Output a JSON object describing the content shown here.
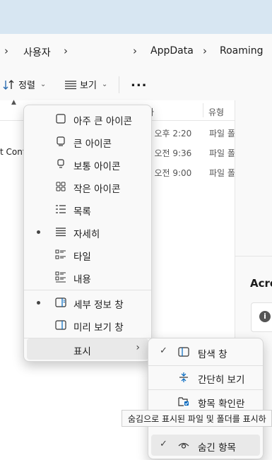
{
  "address": {
    "crumbs": [
      "사용자",
      "AppData",
      "Roaming"
    ]
  },
  "toolbar": {
    "sort_label": "정렬",
    "view_label": "보기",
    "more_label": "..."
  },
  "filelist": {
    "col_date_fragment": "가",
    "col_type": "유형",
    "left_fragment": "t Cont",
    "rows": [
      {
        "date": "4 오후 2:20",
        "type": "파일 폴"
      },
      {
        "date": "5 오전 9:36",
        "type": "파일 폴"
      },
      {
        "date": "2 오전 9:00",
        "type": "파일 폴"
      }
    ]
  },
  "detail_pane": {
    "title_fragment": "Acro",
    "info_icon": "i"
  },
  "view_menu": {
    "items": [
      {
        "label": "아주 큰 아이콘",
        "icon": "xl-icon"
      },
      {
        "label": "큰 아이콘",
        "icon": "large-icon"
      },
      {
        "label": "보통 아이콘",
        "icon": "medium-icon"
      },
      {
        "label": "작은 아이콘",
        "icon": "small-icons-icon"
      },
      {
        "label": "목록",
        "icon": "list-icon"
      },
      {
        "label": "자세히",
        "icon": "details-icon",
        "selected": true
      },
      {
        "label": "타일",
        "icon": "tiles-icon"
      },
      {
        "label": "내용",
        "icon": "content-icon"
      },
      {
        "label": "세부 정보 창",
        "icon": "details-pane-icon",
        "selected": true
      },
      {
        "label": "미리 보기 창",
        "icon": "preview-pane-icon"
      },
      {
        "label": "표시",
        "icon": "",
        "submenu": true
      }
    ]
  },
  "show_menu": {
    "items": [
      {
        "label": "탐색 창",
        "icon": "nav-pane-icon",
        "checked": true
      },
      {
        "label": "간단히 보기",
        "icon": "compact-view-icon"
      },
      {
        "label": "항목 확인란",
        "icon": "checkbox-icon"
      },
      {
        "label": "숨긴 항목",
        "icon": "hidden-items-icon",
        "checked": true
      }
    ]
  },
  "tooltip": "숨김으로 표시된 파일 및 폴더를 표시하",
  "colors": {
    "accent": "#0067c0",
    "menu_bg": "#f9f9f9",
    "hover": "#e9e9e9"
  }
}
